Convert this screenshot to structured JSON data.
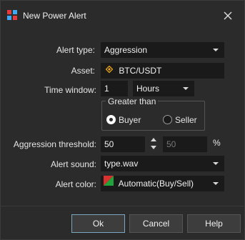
{
  "window": {
    "title": "New Power Alert",
    "icon": "app-grid-icon",
    "close_icon": "close-icon"
  },
  "form": {
    "alert_type": {
      "label": "Alert type:",
      "value": "Aggression"
    },
    "asset": {
      "label": "Asset:",
      "value": "BTC/USDT",
      "icon": "diamond-asset-icon"
    },
    "time_window": {
      "label": "Time window:",
      "value": "1",
      "unit": "Hours"
    },
    "comparison": {
      "group_title": "Greater than",
      "options": [
        {
          "label": "Buyer",
          "checked": true
        },
        {
          "label": "Seller",
          "checked": false
        }
      ]
    },
    "aggression_threshold": {
      "label": "Aggression threshold:",
      "value": "50",
      "percent_value": "50",
      "percent_symbol": "%"
    },
    "alert_sound": {
      "label": "Alert sound:",
      "value": "type.wav"
    },
    "alert_color": {
      "label": "Alert color:",
      "value": "Automatic(Buy/Sell)",
      "swatch_colors": [
        "#d93030",
        "#1fa33a"
      ]
    }
  },
  "buttons": {
    "ok": "Ok",
    "cancel": "Cancel",
    "help": "Help"
  },
  "colors": {
    "background": "#2b2b2b",
    "field": "#1a1a1a",
    "accent_border": "#7aa6c2",
    "asset_icon": "#e8a21b"
  }
}
